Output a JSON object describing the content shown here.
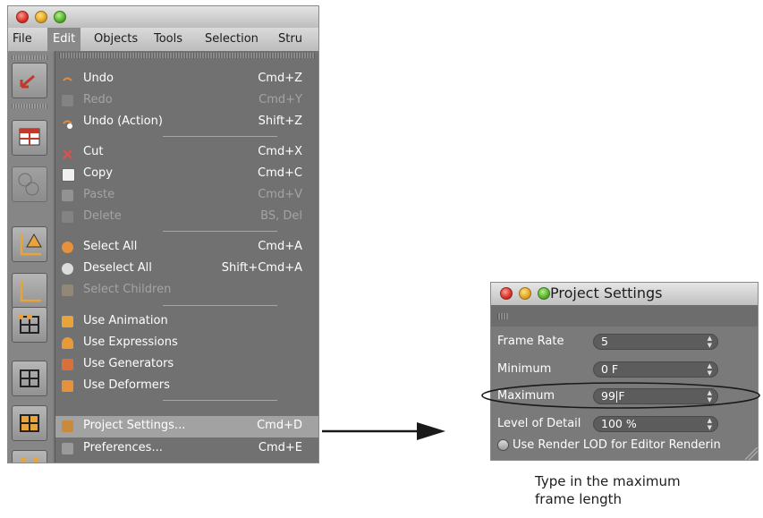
{
  "app": {
    "menubar": [
      {
        "label": "File"
      },
      {
        "label": "Edit",
        "active": true
      },
      {
        "label": "Objects"
      },
      {
        "label": "Tools"
      },
      {
        "label": "Selection"
      },
      {
        "label": "Stru"
      }
    ]
  },
  "edit_menu": {
    "items": [
      {
        "label": "Undo",
        "shortcut": "Cmd+Z",
        "icon": "undo-icon",
        "enabled": true
      },
      {
        "label": "Redo",
        "shortcut": "Cmd+Y",
        "icon": "redo-icon",
        "enabled": false
      },
      {
        "label": "Undo (Action)",
        "shortcut": "Shift+Z",
        "icon": "undo-action-icon",
        "enabled": true
      },
      {
        "label": "Cut",
        "shortcut": "Cmd+X",
        "icon": "scissors-icon",
        "enabled": true
      },
      {
        "label": "Copy",
        "shortcut": "Cmd+C",
        "icon": "copy-icon",
        "enabled": true
      },
      {
        "label": "Paste",
        "shortcut": "Cmd+V",
        "icon": "paste-icon",
        "enabled": false
      },
      {
        "label": "Delete",
        "shortcut": "BS, Del",
        "icon": "delete-icon",
        "enabled": false
      },
      {
        "label": "Select All",
        "shortcut": "Cmd+A",
        "icon": "select-all-icon",
        "enabled": true
      },
      {
        "label": "Deselect All",
        "shortcut": "Shift+Cmd+A",
        "icon": "deselect-all-icon",
        "enabled": true
      },
      {
        "label": "Select Children",
        "shortcut": "",
        "icon": "select-children-icon",
        "enabled": false
      },
      {
        "label": "Use Animation",
        "shortcut": "",
        "icon": "animation-icon",
        "enabled": true
      },
      {
        "label": "Use Expressions",
        "shortcut": "",
        "icon": "expressions-icon",
        "enabled": true
      },
      {
        "label": "Use Generators",
        "shortcut": "",
        "icon": "generators-icon",
        "enabled": true
      },
      {
        "label": "Use Deformers",
        "shortcut": "",
        "icon": "deformers-icon",
        "enabled": true
      },
      {
        "label": "Project Settings...",
        "shortcut": "Cmd+D",
        "icon": "project-settings-icon",
        "enabled": true,
        "highlighted": true
      },
      {
        "label": "Preferences...",
        "shortcut": "Cmd+E",
        "icon": "preferences-icon",
        "enabled": true
      }
    ]
  },
  "project_settings": {
    "title": "Project Settings",
    "fields": [
      {
        "label": "Frame Rate",
        "value": "5"
      },
      {
        "label": "Minimum",
        "value": "0 F"
      },
      {
        "label": "Maximum",
        "value_before_cursor": "99",
        "value_after_cursor": "F"
      },
      {
        "label": "Level of Detail",
        "value": "100 %"
      }
    ],
    "checkbox_label": "Use Render LOD for Editor Renderin"
  },
  "caption": {
    "line1": "Type in the maximum",
    "line2": "frame length"
  },
  "colors": {
    "menu_bg": "#717171",
    "menu_highlight": "#a2a2a2",
    "panel_bg": "#7a7a7a",
    "field_bg": "#5c5c5c"
  }
}
